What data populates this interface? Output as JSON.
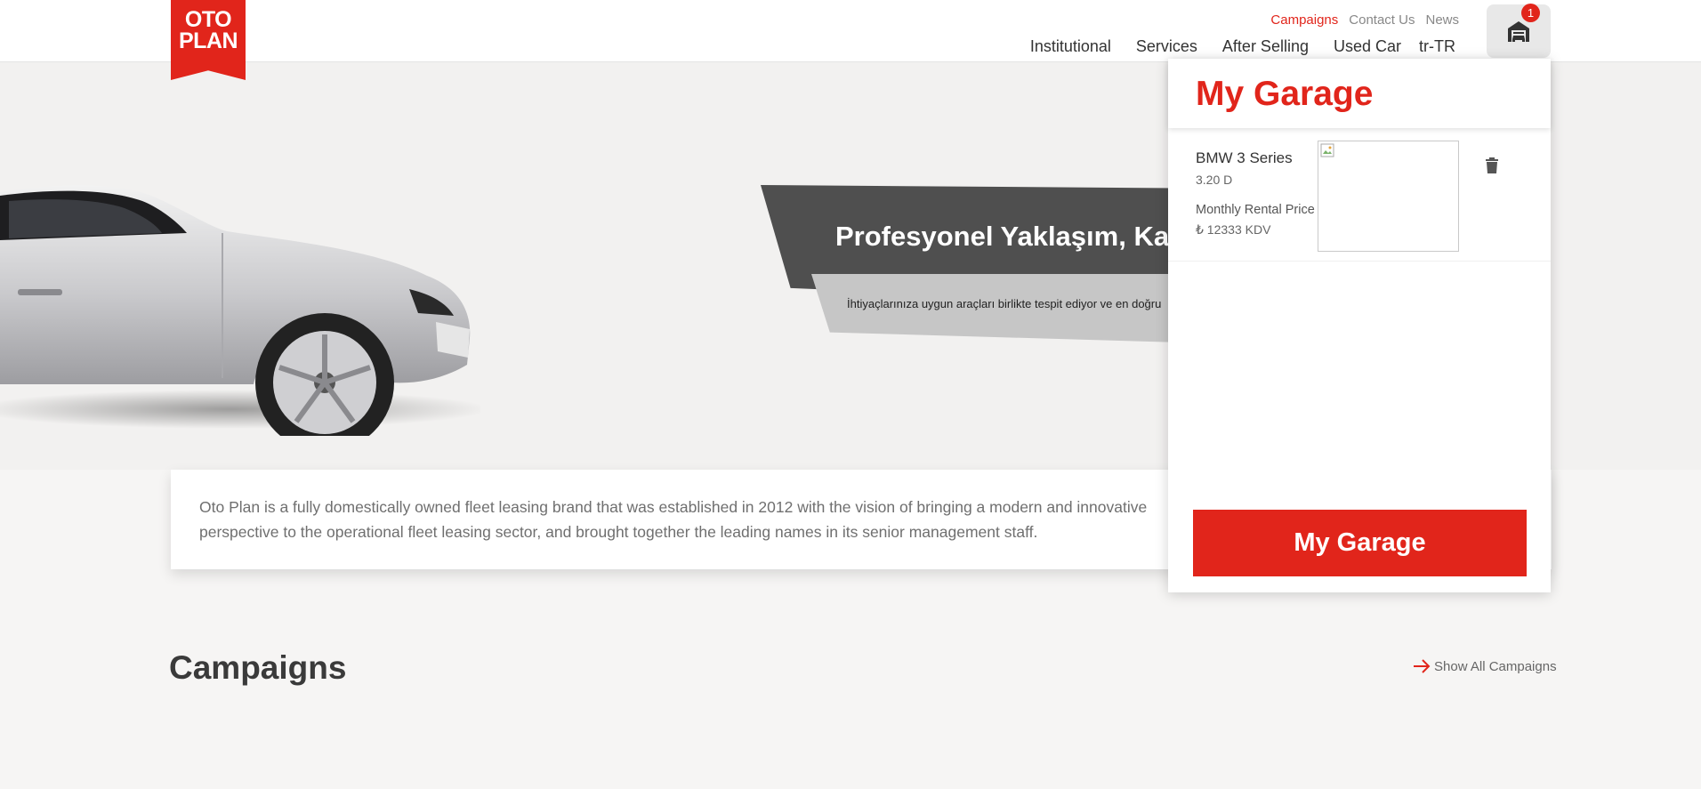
{
  "brand": {
    "logo_line1": "OTO",
    "logo_line2": "PLAN",
    "accent_color": "#e1251b"
  },
  "top_nav": {
    "campaigns": "Campaigns",
    "contact": "Contact Us",
    "news": "News"
  },
  "main_nav": {
    "institutional": "Institutional",
    "services": "Services",
    "after_selling": "After Selling",
    "used_car": "Used Car",
    "language": "tr-TR"
  },
  "garage_button": {
    "icon": "garage-icon",
    "badge_count": "1"
  },
  "hero": {
    "title": "Profesyonel Yaklaşım, Kali",
    "subtitle": "İhtiyaçlarınıza uygun araçları birlikte tespit ediyor ve en doğru"
  },
  "intro": {
    "text": "Oto Plan is a fully domestically owned fleet leasing brand that was established in 2012 with the vision of bringing a modern and innovative perspective to the operational fleet leasing sector, and brought together the leading names in its senior management staff."
  },
  "campaigns": {
    "title": "Campaigns",
    "show_all": "Show All Campaigns"
  },
  "garage_panel": {
    "title": "My Garage",
    "items": [
      {
        "name": "BMW 3 Series",
        "variant": "3.20 D",
        "price_label": "Monthly Rental Price",
        "price": "₺ 12333 KDV"
      }
    ],
    "cta": "My Garage"
  }
}
